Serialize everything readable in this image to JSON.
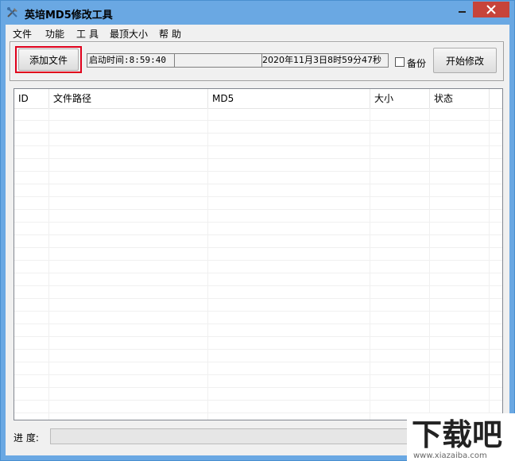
{
  "window": {
    "title": "英培MD5修改工具"
  },
  "menu": {
    "items": [
      "文件",
      "功能",
      "工具",
      "最顶大小",
      "帮助"
    ]
  },
  "toolbar": {
    "add_label": "添加文件",
    "start_label": "开始修改",
    "backup_label": "备份",
    "backup_checked": false,
    "status_start": "启动时间:8:59:40",
    "status_middle": "",
    "status_datetime": "2020年11月3日8时59分47秒"
  },
  "list": {
    "columns": [
      "ID",
      "文件路径",
      "MD5",
      "大小",
      "状态"
    ],
    "rows": []
  },
  "progress": {
    "label": "进  度:",
    "value": 0
  },
  "watermark": {
    "text": "下载吧",
    "sub": "www.xiazaiba.com"
  },
  "colors": {
    "titlebar": "#6aa8e3",
    "close": "#c7443a",
    "highlight": "#e0001b"
  },
  "icons": {
    "app": "tools-icon",
    "minimize": "minimize-icon",
    "close": "close-icon"
  }
}
